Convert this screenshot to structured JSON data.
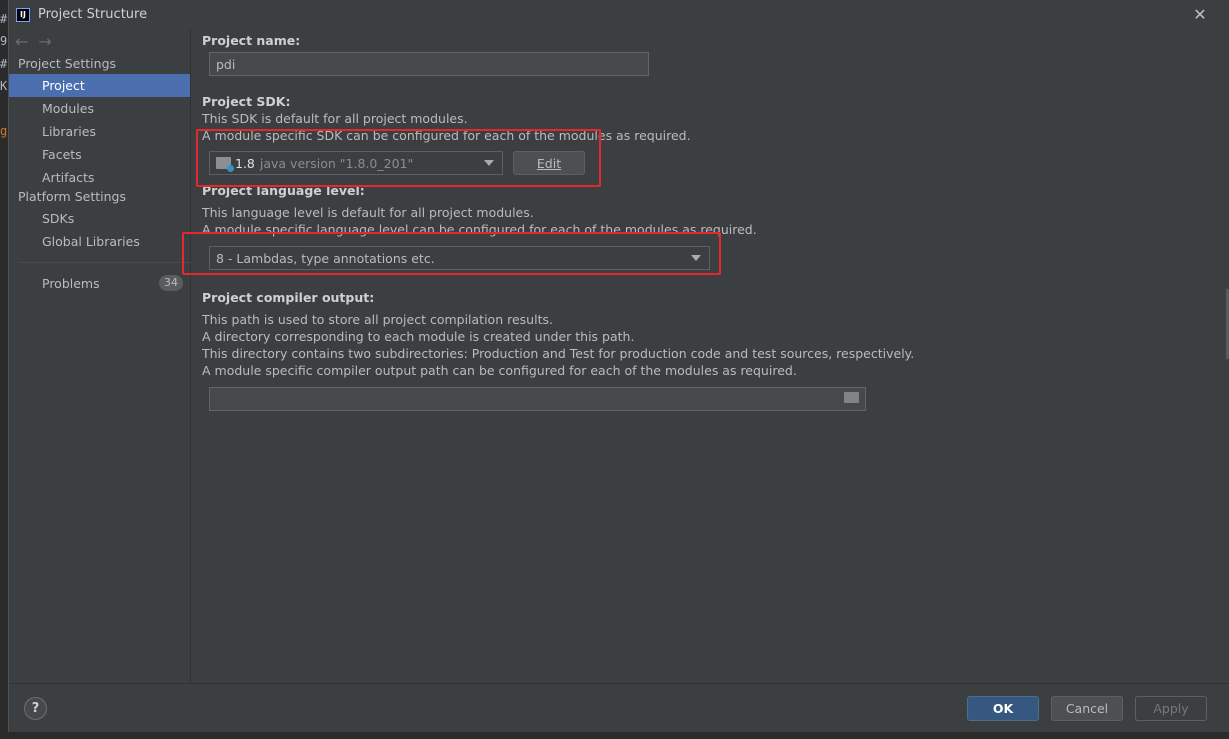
{
  "window": {
    "title": "Project Structure"
  },
  "background_fragments": [
    "#",
    "9",
    "#",
    "K",
    "g"
  ],
  "sidebar": {
    "project_settings_label": "Project Settings",
    "project_settings_items": [
      {
        "label": "Project",
        "selected": true
      },
      {
        "label": "Modules"
      },
      {
        "label": "Libraries"
      },
      {
        "label": "Facets"
      },
      {
        "label": "Artifacts"
      }
    ],
    "platform_settings_label": "Platform Settings",
    "platform_settings_items": [
      {
        "label": "SDKs"
      },
      {
        "label": "Global Libraries"
      }
    ],
    "problems": {
      "label": "Problems",
      "count": "34"
    }
  },
  "project": {
    "name_label": "Project name:",
    "name_value": "pdi",
    "sdk_label": "Project SDK:",
    "sdk_desc1": "This SDK is default for all project modules.",
    "sdk_desc2": "A module specific SDK can be configured for each of the modules as required.",
    "sdk_version": "1.8",
    "sdk_detail": "java version \"1.8.0_201\"",
    "sdk_edit": "Edit",
    "lang_label": "Project language level:",
    "lang_desc1": "This language level is default for all project modules.",
    "lang_desc2": "A module specific language level can be configured for each of the modules as required.",
    "lang_value": "8 - Lambdas, type annotations etc.",
    "output_label": "Project compiler output:",
    "output_desc1": "This path is used to store all project compilation results.",
    "output_desc2": "A directory corresponding to each module is created under this path.",
    "output_desc3": "This directory contains two subdirectories: Production and Test for production code and test sources, respectively.",
    "output_desc4": "A module specific compiler output path can be configured for each of the modules as required.",
    "output_value": ""
  },
  "footer": {
    "help": "?",
    "ok": "OK",
    "cancel": "Cancel",
    "apply": "Apply"
  },
  "colors": {
    "accent_selected": "#4b6eaf",
    "primary_button": "#365880",
    "annotation_red": "#e5282e"
  }
}
